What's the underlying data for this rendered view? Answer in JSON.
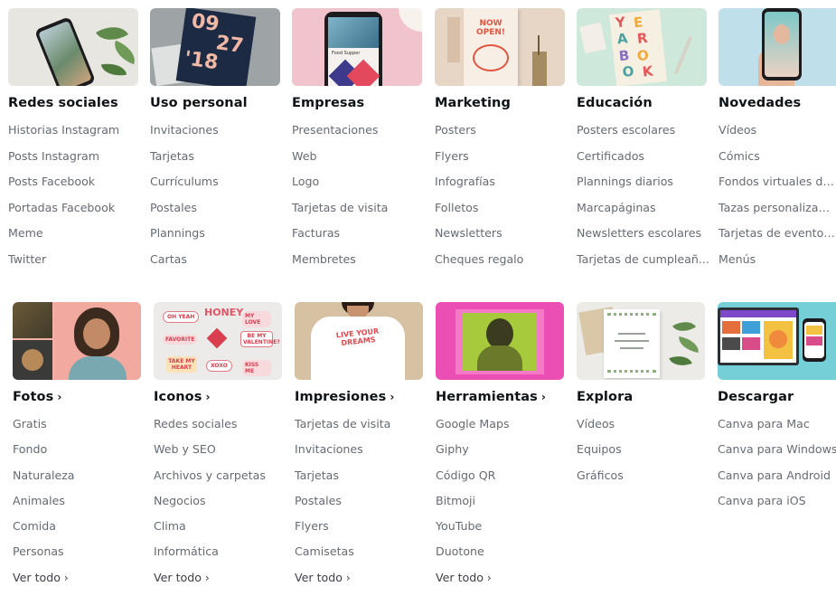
{
  "row1": [
    {
      "title": "Redes sociales",
      "links": [
        "Historias Instagram",
        "Posts Instagram",
        "Posts Facebook",
        "Portadas Facebook",
        "Meme",
        "Twitter"
      ]
    },
    {
      "title": "Uso personal",
      "links": [
        "Invitaciones",
        "Tarjetas",
        "Currículums",
        "Postales",
        "Plannings",
        "Cartas"
      ],
      "card_top": "09",
      "card_mid": "27",
      "card_year": "'18"
    },
    {
      "title": "Empresas",
      "links": [
        "Presentaciones",
        "Web",
        "Logo",
        "Tarjetas de visita",
        "Facturas",
        "Membretes"
      ],
      "phone_caption": "Food Supper"
    },
    {
      "title": "Marketing",
      "links": [
        "Posters",
        "Flyers",
        "Infografías",
        "Folletos",
        "Newsletters",
        "Cheques regalo"
      ],
      "poster_text": "NOW OPEN!"
    },
    {
      "title": "Educación",
      "links": [
        "Posters escolares",
        "Certificados",
        "Plannings diarios",
        "Marcapáginas",
        "Newsletters escolares",
        "Tarjetas de cumpleañ..."
      ],
      "book_letters": [
        "Y",
        "E",
        "A",
        "R",
        "B",
        "O",
        "O",
        "K"
      ]
    },
    {
      "title": "Novedades",
      "links": [
        "Vídeos",
        "Cómics",
        "Fondos virtuales de Z...",
        "Tazas personalizadas",
        "Tarjetas de eventos y...",
        "Menús"
      ]
    }
  ],
  "row2": [
    {
      "title": "Fotos",
      "links": [
        "Gratis",
        "Fondo",
        "Naturaleza",
        "Animales",
        "Comida",
        "Personas",
        "Ver todo"
      ]
    },
    {
      "title": "Iconos",
      "links": [
        "Redes sociales",
        "Web y SEO",
        "Archivos y carpetas",
        "Negocios",
        "Clima",
        "Informática",
        "Ver todo"
      ],
      "stickers": [
        "OH YEAH",
        "HONEY",
        "MY LOVE",
        "FAVORITE",
        "BE MY VALENTINE?",
        "TAKE MY HEART",
        "XOXO",
        "KISS ME"
      ]
    },
    {
      "title": "Impresiones",
      "links": [
        "Tarjetas de visita",
        "Invitaciones",
        "Tarjetas",
        "Postales",
        "Flyers",
        "Camisetas",
        "Ver todo"
      ],
      "shirt_text": "LIVE YOUR DREAMS"
    },
    {
      "title": "Herramientas",
      "links": [
        "Google Maps",
        "Giphy",
        "Código QR",
        "Bitmoji",
        "YouTube",
        "Duotone",
        "Ver todo"
      ]
    },
    {
      "title": "Explora",
      "links": [
        "Vídeos",
        "Equipos",
        "Gráficos"
      ]
    },
    {
      "title": "Descargar",
      "links": [
        "Canva para Mac",
        "Canva para Windows",
        "Canva para Android",
        "Canva para iOS"
      ]
    }
  ],
  "chevron": "›"
}
